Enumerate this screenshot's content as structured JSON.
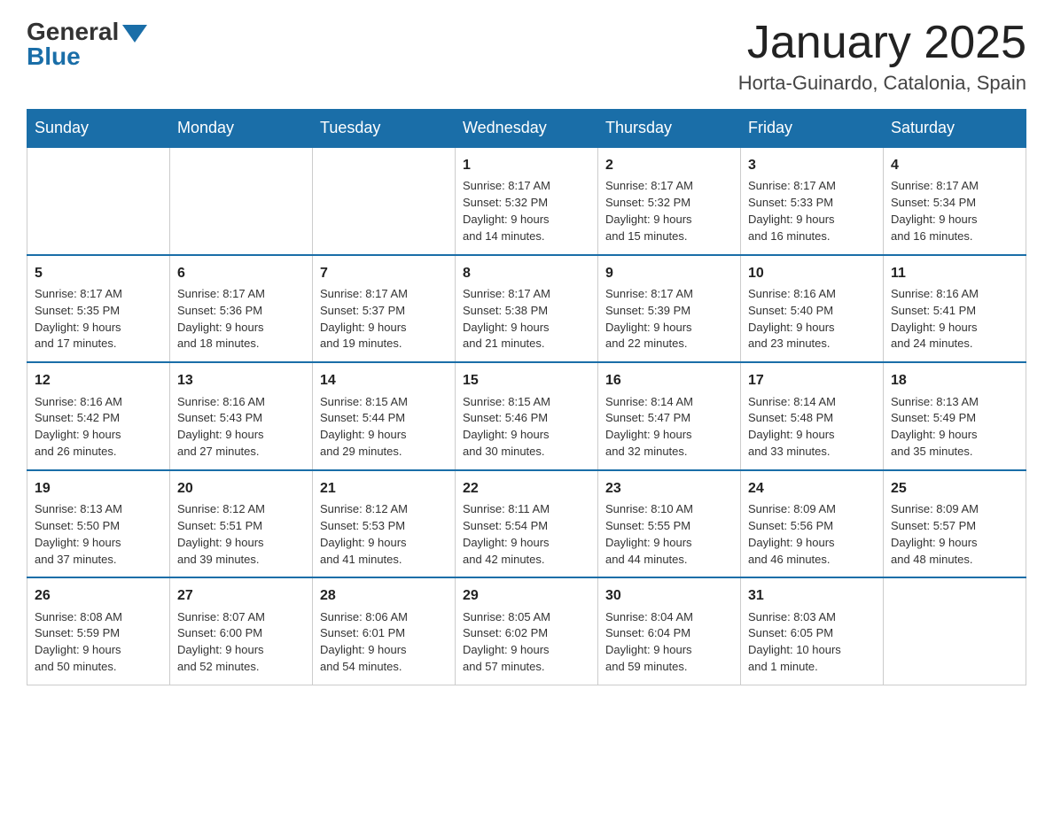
{
  "header": {
    "logo_general": "General",
    "logo_blue": "Blue",
    "month_title": "January 2025",
    "location": "Horta-Guinardo, Catalonia, Spain"
  },
  "weekdays": [
    "Sunday",
    "Monday",
    "Tuesday",
    "Wednesday",
    "Thursday",
    "Friday",
    "Saturday"
  ],
  "weeks": [
    [
      {
        "day": "",
        "info": ""
      },
      {
        "day": "",
        "info": ""
      },
      {
        "day": "",
        "info": ""
      },
      {
        "day": "1",
        "info": "Sunrise: 8:17 AM\nSunset: 5:32 PM\nDaylight: 9 hours\nand 14 minutes."
      },
      {
        "day": "2",
        "info": "Sunrise: 8:17 AM\nSunset: 5:32 PM\nDaylight: 9 hours\nand 15 minutes."
      },
      {
        "day": "3",
        "info": "Sunrise: 8:17 AM\nSunset: 5:33 PM\nDaylight: 9 hours\nand 16 minutes."
      },
      {
        "day": "4",
        "info": "Sunrise: 8:17 AM\nSunset: 5:34 PM\nDaylight: 9 hours\nand 16 minutes."
      }
    ],
    [
      {
        "day": "5",
        "info": "Sunrise: 8:17 AM\nSunset: 5:35 PM\nDaylight: 9 hours\nand 17 minutes."
      },
      {
        "day": "6",
        "info": "Sunrise: 8:17 AM\nSunset: 5:36 PM\nDaylight: 9 hours\nand 18 minutes."
      },
      {
        "day": "7",
        "info": "Sunrise: 8:17 AM\nSunset: 5:37 PM\nDaylight: 9 hours\nand 19 minutes."
      },
      {
        "day": "8",
        "info": "Sunrise: 8:17 AM\nSunset: 5:38 PM\nDaylight: 9 hours\nand 21 minutes."
      },
      {
        "day": "9",
        "info": "Sunrise: 8:17 AM\nSunset: 5:39 PM\nDaylight: 9 hours\nand 22 minutes."
      },
      {
        "day": "10",
        "info": "Sunrise: 8:16 AM\nSunset: 5:40 PM\nDaylight: 9 hours\nand 23 minutes."
      },
      {
        "day": "11",
        "info": "Sunrise: 8:16 AM\nSunset: 5:41 PM\nDaylight: 9 hours\nand 24 minutes."
      }
    ],
    [
      {
        "day": "12",
        "info": "Sunrise: 8:16 AM\nSunset: 5:42 PM\nDaylight: 9 hours\nand 26 minutes."
      },
      {
        "day": "13",
        "info": "Sunrise: 8:16 AM\nSunset: 5:43 PM\nDaylight: 9 hours\nand 27 minutes."
      },
      {
        "day": "14",
        "info": "Sunrise: 8:15 AM\nSunset: 5:44 PM\nDaylight: 9 hours\nand 29 minutes."
      },
      {
        "day": "15",
        "info": "Sunrise: 8:15 AM\nSunset: 5:46 PM\nDaylight: 9 hours\nand 30 minutes."
      },
      {
        "day": "16",
        "info": "Sunrise: 8:14 AM\nSunset: 5:47 PM\nDaylight: 9 hours\nand 32 minutes."
      },
      {
        "day": "17",
        "info": "Sunrise: 8:14 AM\nSunset: 5:48 PM\nDaylight: 9 hours\nand 33 minutes."
      },
      {
        "day": "18",
        "info": "Sunrise: 8:13 AM\nSunset: 5:49 PM\nDaylight: 9 hours\nand 35 minutes."
      }
    ],
    [
      {
        "day": "19",
        "info": "Sunrise: 8:13 AM\nSunset: 5:50 PM\nDaylight: 9 hours\nand 37 minutes."
      },
      {
        "day": "20",
        "info": "Sunrise: 8:12 AM\nSunset: 5:51 PM\nDaylight: 9 hours\nand 39 minutes."
      },
      {
        "day": "21",
        "info": "Sunrise: 8:12 AM\nSunset: 5:53 PM\nDaylight: 9 hours\nand 41 minutes."
      },
      {
        "day": "22",
        "info": "Sunrise: 8:11 AM\nSunset: 5:54 PM\nDaylight: 9 hours\nand 42 minutes."
      },
      {
        "day": "23",
        "info": "Sunrise: 8:10 AM\nSunset: 5:55 PM\nDaylight: 9 hours\nand 44 minutes."
      },
      {
        "day": "24",
        "info": "Sunrise: 8:09 AM\nSunset: 5:56 PM\nDaylight: 9 hours\nand 46 minutes."
      },
      {
        "day": "25",
        "info": "Sunrise: 8:09 AM\nSunset: 5:57 PM\nDaylight: 9 hours\nand 48 minutes."
      }
    ],
    [
      {
        "day": "26",
        "info": "Sunrise: 8:08 AM\nSunset: 5:59 PM\nDaylight: 9 hours\nand 50 minutes."
      },
      {
        "day": "27",
        "info": "Sunrise: 8:07 AM\nSunset: 6:00 PM\nDaylight: 9 hours\nand 52 minutes."
      },
      {
        "day": "28",
        "info": "Sunrise: 8:06 AM\nSunset: 6:01 PM\nDaylight: 9 hours\nand 54 minutes."
      },
      {
        "day": "29",
        "info": "Sunrise: 8:05 AM\nSunset: 6:02 PM\nDaylight: 9 hours\nand 57 minutes."
      },
      {
        "day": "30",
        "info": "Sunrise: 8:04 AM\nSunset: 6:04 PM\nDaylight: 9 hours\nand 59 minutes."
      },
      {
        "day": "31",
        "info": "Sunrise: 8:03 AM\nSunset: 6:05 PM\nDaylight: 10 hours\nand 1 minute."
      },
      {
        "day": "",
        "info": ""
      }
    ]
  ]
}
